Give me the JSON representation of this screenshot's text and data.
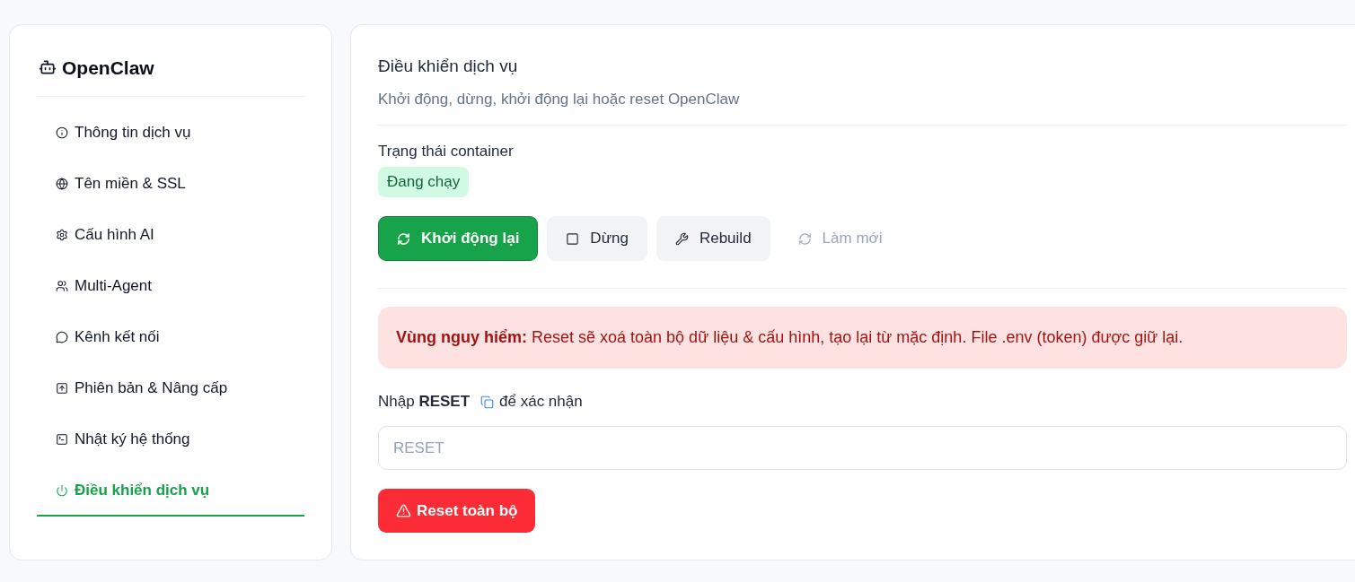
{
  "sidebar": {
    "brand": "OpenClaw",
    "items": [
      {
        "label": "Thông tin dịch vụ",
        "selected": false
      },
      {
        "label": "Tên miền & SSL",
        "selected": false
      },
      {
        "label": "Cấu hình AI",
        "selected": false
      },
      {
        "label": "Multi-Agent",
        "selected": false
      },
      {
        "label": "Kênh kết nối",
        "selected": false
      },
      {
        "label": "Phiên bản & Nâng cấp",
        "selected": false
      },
      {
        "label": "Nhật ký hệ thống",
        "selected": false
      },
      {
        "label": "Điều khiển dịch vụ",
        "selected": true
      }
    ]
  },
  "panel": {
    "title": "Điều khiển dịch vụ",
    "subtitle": "Khởi động, dừng, khởi động lại hoặc reset OpenClaw",
    "status_label": "Trạng thái container",
    "status_badge": "Đang chạy",
    "actions": [
      {
        "label": "Khởi động lại",
        "kind": "primary"
      },
      {
        "label": "Dừng",
        "kind": "secondary"
      },
      {
        "label": "Rebuild",
        "kind": "secondary"
      },
      {
        "label": "Làm mới",
        "kind": "ghost"
      }
    ],
    "danger_alert": "**Vùng nguy hiểm:** Reset sẽ xoá toàn bộ dữ liệu & cấu hình, tạo lại từ mặc định. File .env (token) được giữ lại.",
    "confirm_label": {
      "before": "Nhập **RESET**",
      "after": "để xác nhận"
    },
    "confirm_input": {
      "placeholder": "RESET"
    },
    "reset_button": "Reset toàn bộ"
  }
}
